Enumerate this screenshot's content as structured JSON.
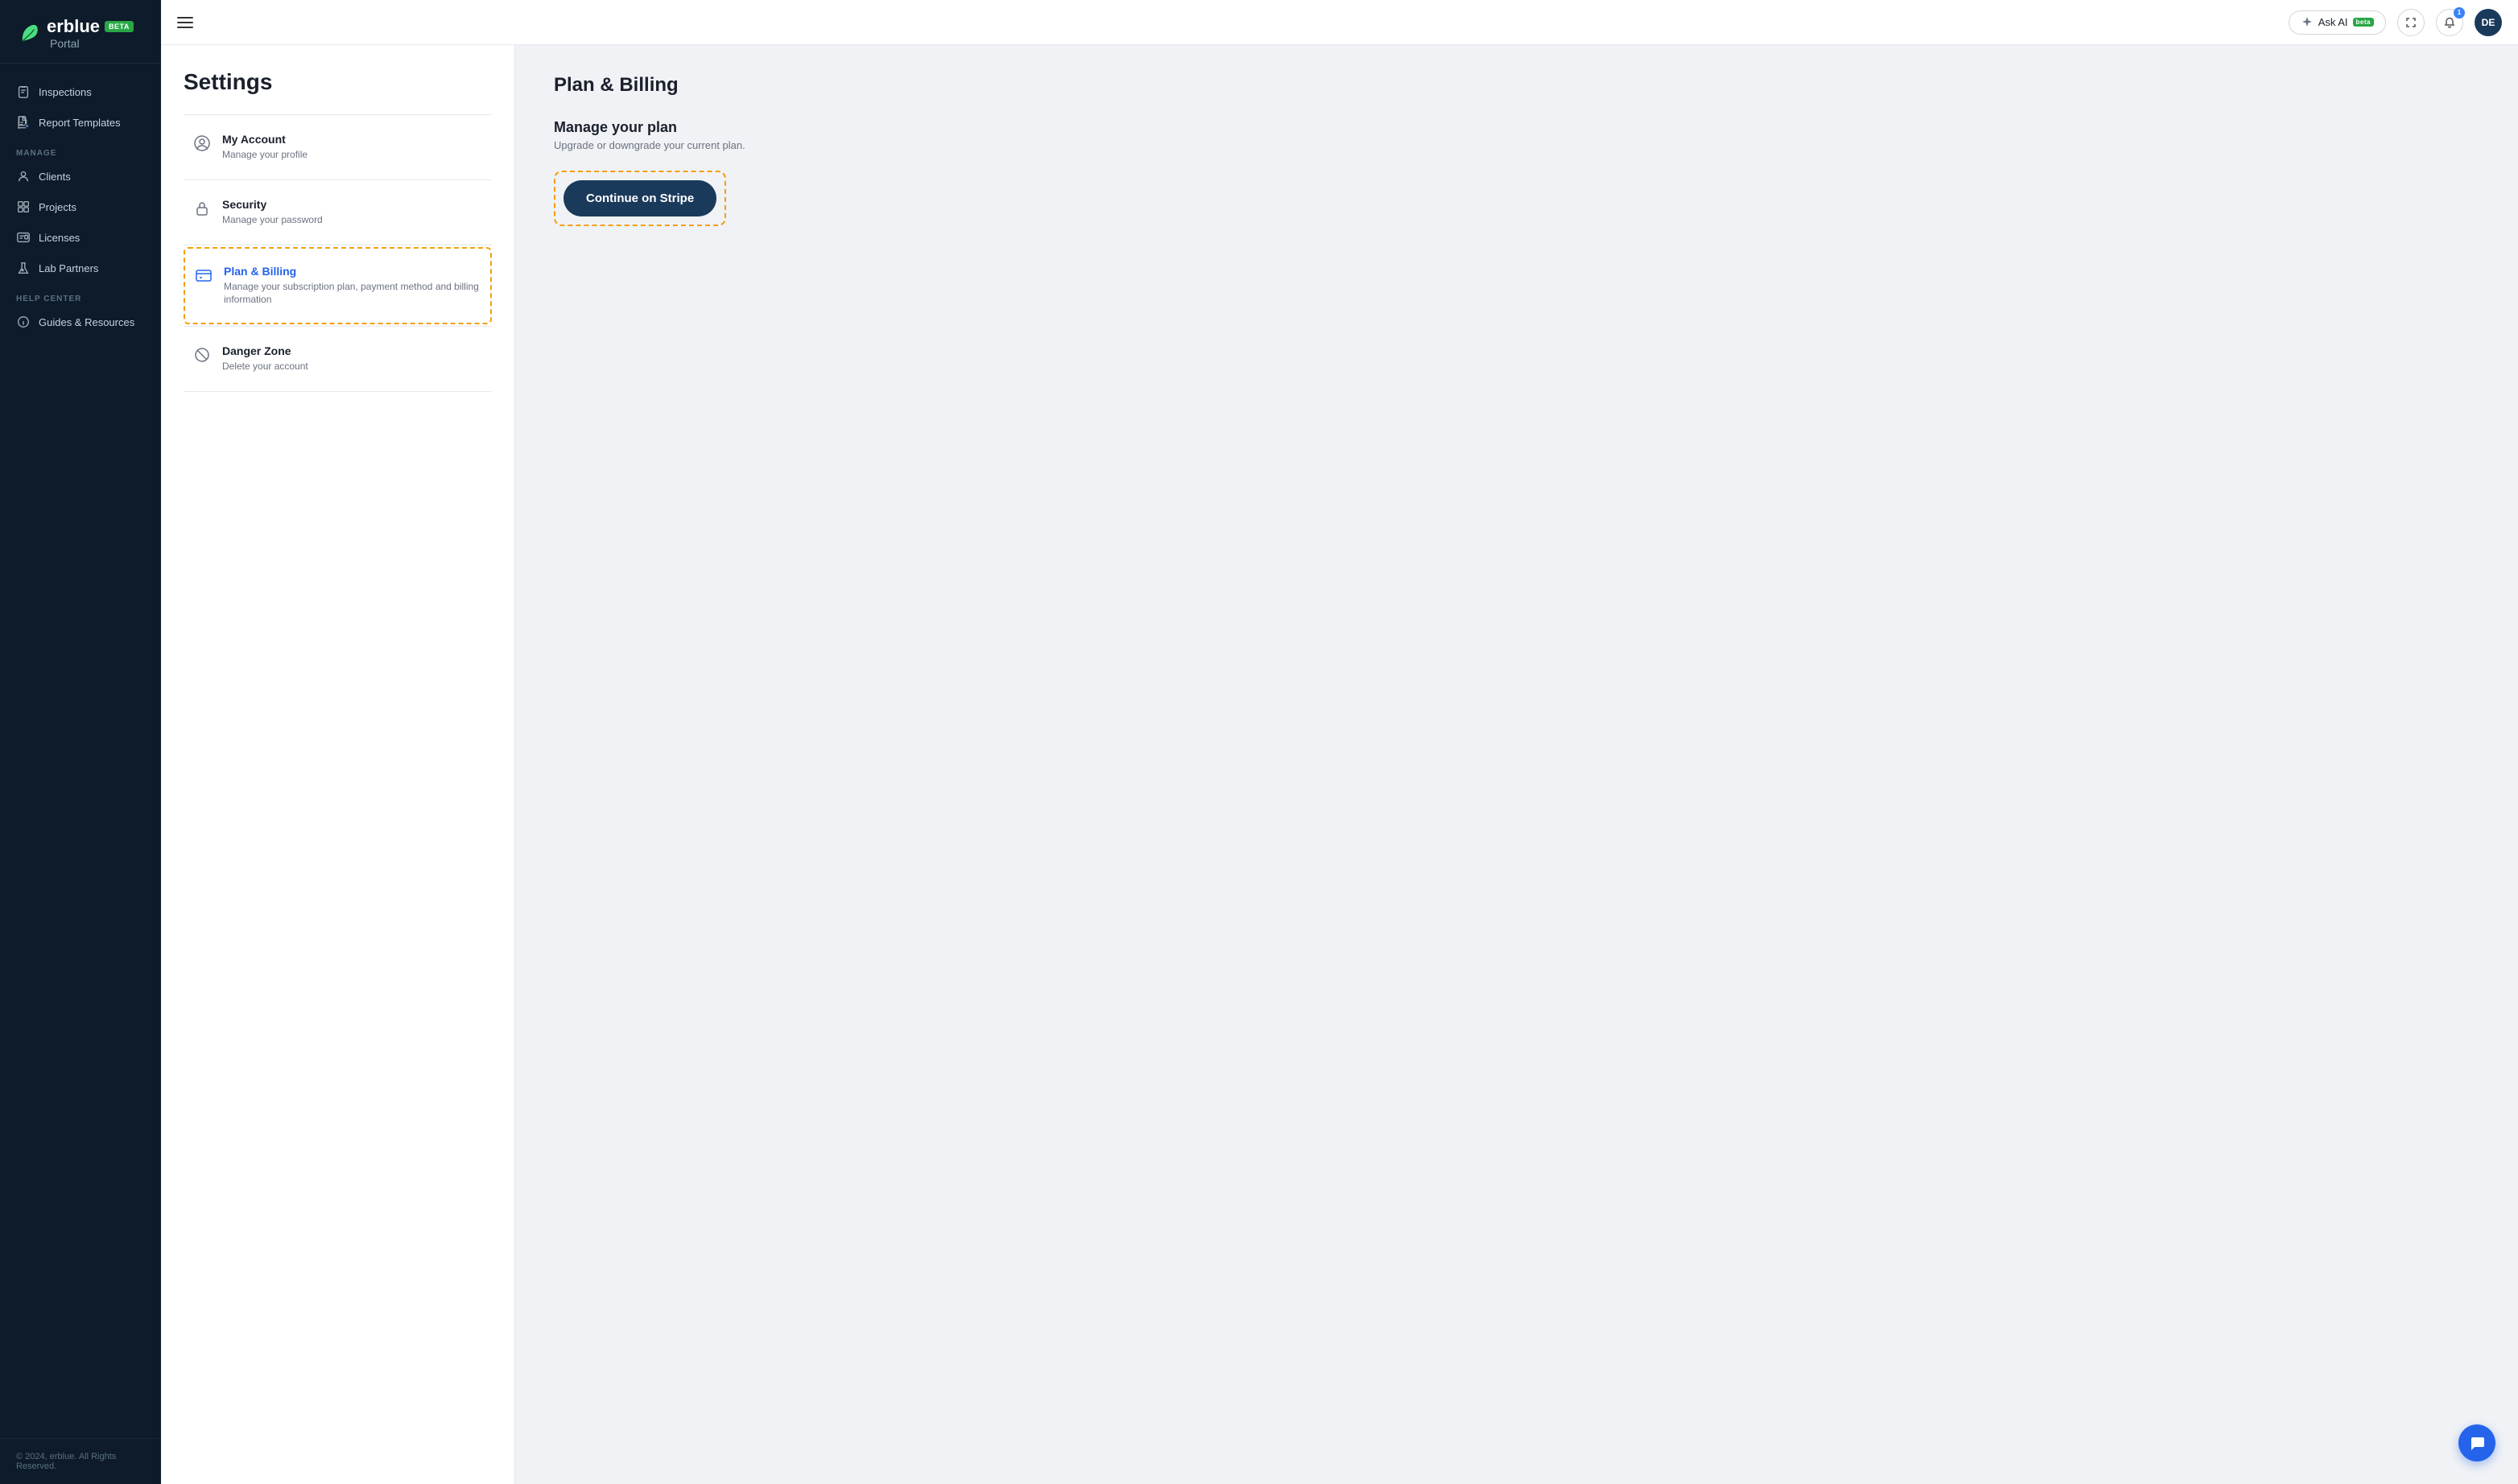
{
  "sidebar": {
    "logo_name": "erblue",
    "logo_sub": "Portal",
    "beta_label": "BETA",
    "nav_items": [
      {
        "id": "inspections",
        "label": "Inspections",
        "icon": "clipboard-icon"
      },
      {
        "id": "report-templates",
        "label": "Report Templates",
        "icon": "file-icon"
      }
    ],
    "manage_section_label": "MANAGE",
    "manage_items": [
      {
        "id": "clients",
        "label": "Clients",
        "icon": "person-icon"
      },
      {
        "id": "projects",
        "label": "Projects",
        "icon": "grid-icon"
      },
      {
        "id": "licenses",
        "label": "Licenses",
        "icon": "license-icon"
      },
      {
        "id": "lab-partners",
        "label": "Lab Partners",
        "icon": "lab-icon"
      }
    ],
    "help_section_label": "HELP CENTER",
    "help_items": [
      {
        "id": "guides",
        "label": "Guides & Resources",
        "icon": "info-icon"
      }
    ],
    "footer": "© 2024, erblue. All Rights Reserved."
  },
  "topbar": {
    "ask_ai_label": "Ask AI",
    "ai_beta_label": "beta",
    "notification_count": "1",
    "avatar_initials": "DE"
  },
  "settings": {
    "title": "Settings",
    "menu_items": [
      {
        "id": "my-account",
        "label": "My Account",
        "desc": "Manage your profile",
        "icon": "person-circle-icon",
        "active": false
      },
      {
        "id": "security",
        "label": "Security",
        "desc": "Manage your password",
        "icon": "lock-icon",
        "active": false
      },
      {
        "id": "plan-billing",
        "label": "Plan & Billing",
        "desc": "Manage your subscription plan, payment method and billing information",
        "icon": "card-icon",
        "active": true
      },
      {
        "id": "danger-zone",
        "label": "Danger Zone",
        "desc": "Delete your account",
        "icon": "ban-icon",
        "active": false
      }
    ]
  },
  "billing": {
    "page_title": "Plan & Billing",
    "manage_heading": "Manage your plan",
    "manage_sub": "Upgrade or downgrade your current plan.",
    "stripe_button_label": "Continue on Stripe"
  },
  "chat_fab": "💬"
}
